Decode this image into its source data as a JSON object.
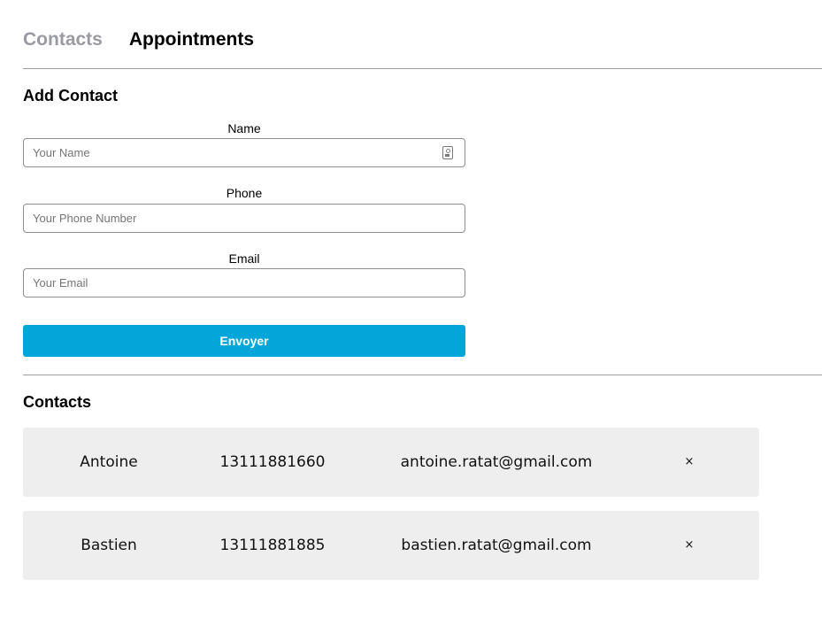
{
  "nav": {
    "tabs": [
      {
        "label": "Contacts",
        "active": false
      },
      {
        "label": "Appointments",
        "active": true
      }
    ]
  },
  "add_contact": {
    "title": "Add Contact",
    "name_label": "Name",
    "name_placeholder": "Your Name",
    "phone_label": "Phone",
    "phone_placeholder": "Your Phone Number",
    "email_label": "Email",
    "email_placeholder": "Your Email",
    "submit_label": "Envoyer",
    "accent_color": "#03a6d9"
  },
  "contacts": {
    "title": "Contacts",
    "remove_symbol": "×",
    "items": [
      {
        "name": "Antoine",
        "phone": "13111881660",
        "email": "antoine.ratat@gmail.com"
      },
      {
        "name": "Bastien",
        "phone": "13111881885",
        "email": "bastien.ratat@gmail.com"
      }
    ]
  },
  "icons": {
    "name_field_icon": "contact-card-icon",
    "remove_icon": "close-icon"
  }
}
